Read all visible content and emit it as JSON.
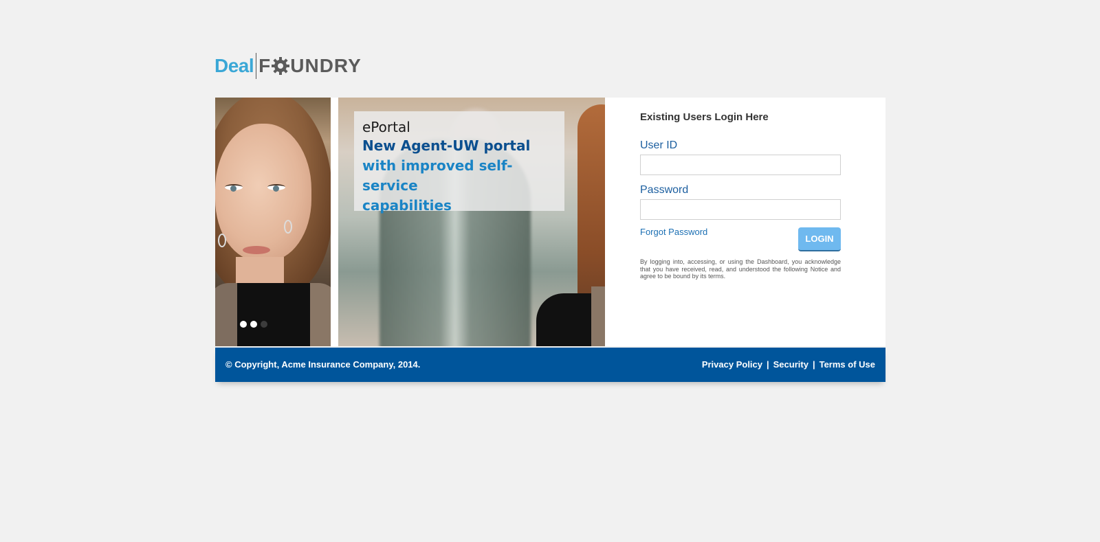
{
  "logo": {
    "part1": "Deal",
    "part2_pre": "F",
    "part2_post": "UNDRY"
  },
  "promo": {
    "title": "ePortal",
    "line1": "New Agent-UW portal",
    "line2": "with improved self-service",
    "line3": "capabilities"
  },
  "carousel": {
    "dots": 3,
    "active": 1
  },
  "login": {
    "title": "Existing Users Login Here",
    "user_label": "User ID",
    "user_value": "",
    "password_label": "Password",
    "password_value": "",
    "forgot": "Forgot Password",
    "button": "LOGIN",
    "legal": "By logging into, accessing, or using the Dashboard, you acknowledge that you have received, read, and understood the following Notice and agree to be bound by its terms."
  },
  "footer": {
    "copyright": "© Copyright, Acme Insurance Company, 2014.",
    "links": [
      "Privacy Policy",
      "Security",
      "Terms of Use"
    ],
    "separator": "|"
  },
  "colors": {
    "brand_blue": "#00559b",
    "logo_blue": "#3aa7d6",
    "button": "#6fb9ef"
  }
}
